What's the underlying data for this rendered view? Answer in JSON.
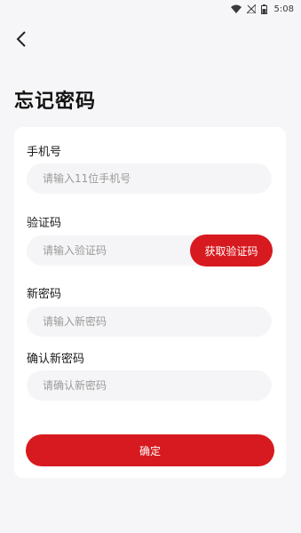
{
  "status_bar": {
    "time": "5:08",
    "icons": [
      "wifi-icon",
      "signal-icon",
      "battery-icon"
    ]
  },
  "header": {
    "back_icon": "back-arrow-icon",
    "title": "忘记密码"
  },
  "form": {
    "phone": {
      "label": "手机号",
      "placeholder": "请输入11位手机号",
      "value": ""
    },
    "code": {
      "label": "验证码",
      "placeholder": "请输入验证码",
      "value": "",
      "button_label": "获取验证码"
    },
    "new_password": {
      "label": "新密码",
      "placeholder": "请输入新密码",
      "value": ""
    },
    "confirm_password": {
      "label": "确认新密码",
      "placeholder": "请确认新密码",
      "value": ""
    },
    "submit_label": "确定"
  },
  "colors": {
    "accent": "#d71a1f",
    "background": "#f6f6f8",
    "card": "#ffffff",
    "input_bg": "#f5f5f7"
  }
}
